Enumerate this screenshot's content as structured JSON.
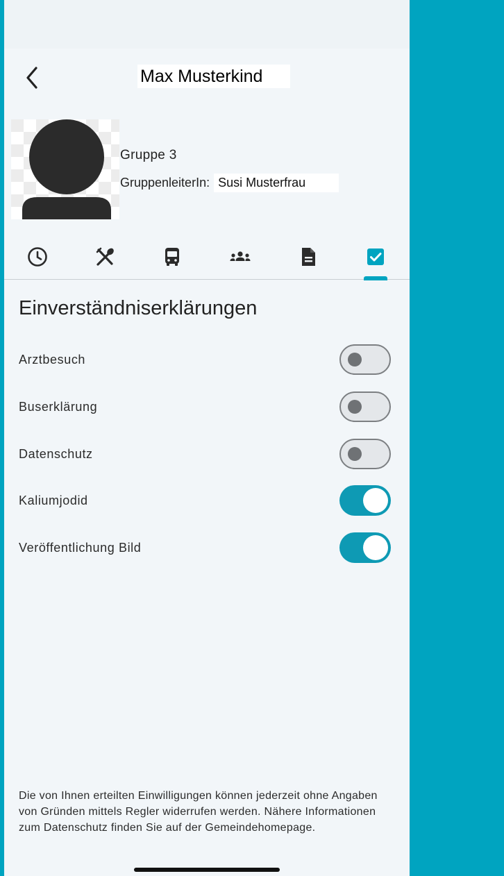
{
  "header": {
    "title": "Max Musterkind",
    "back_icon": "chevron-left-icon"
  },
  "profile": {
    "avatar_icon": "person-silhouette-icon",
    "group": "Gruppe 3",
    "leader_label": "GruppenleiterIn:",
    "leader_name": "Susi Musterfrau"
  },
  "tabs": [
    {
      "icon": "clock-icon",
      "active": false
    },
    {
      "icon": "cutlery-icon",
      "active": false
    },
    {
      "icon": "bus-icon",
      "active": false
    },
    {
      "icon": "people-group-icon",
      "active": false
    },
    {
      "icon": "document-icon",
      "active": false
    },
    {
      "icon": "checkbox-icon",
      "active": true
    }
  ],
  "section": {
    "title": "Einverständniserklärungen"
  },
  "consents": [
    {
      "label": "Arztbesuch",
      "enabled": false
    },
    {
      "label": "Buserklärung",
      "enabled": false
    },
    {
      "label": "Datenschutz",
      "enabled": false
    },
    {
      "label": "Kaliumjodid",
      "enabled": true
    },
    {
      "label": "Veröffentlichung Bild",
      "enabled": true
    }
  ],
  "footer": {
    "note": "Die von Ihnen erteilten Einwilligungen können jederzeit ohne Angaben von Gründen mittels Regler widerrufen werden. Nähere Informationen zum Datenschutz finden Sie auf der Gemeindehomepage."
  },
  "colors": {
    "accent": "#00a4c0",
    "toggle_on": "#0e9ab4",
    "background": "#f2f6f9"
  }
}
